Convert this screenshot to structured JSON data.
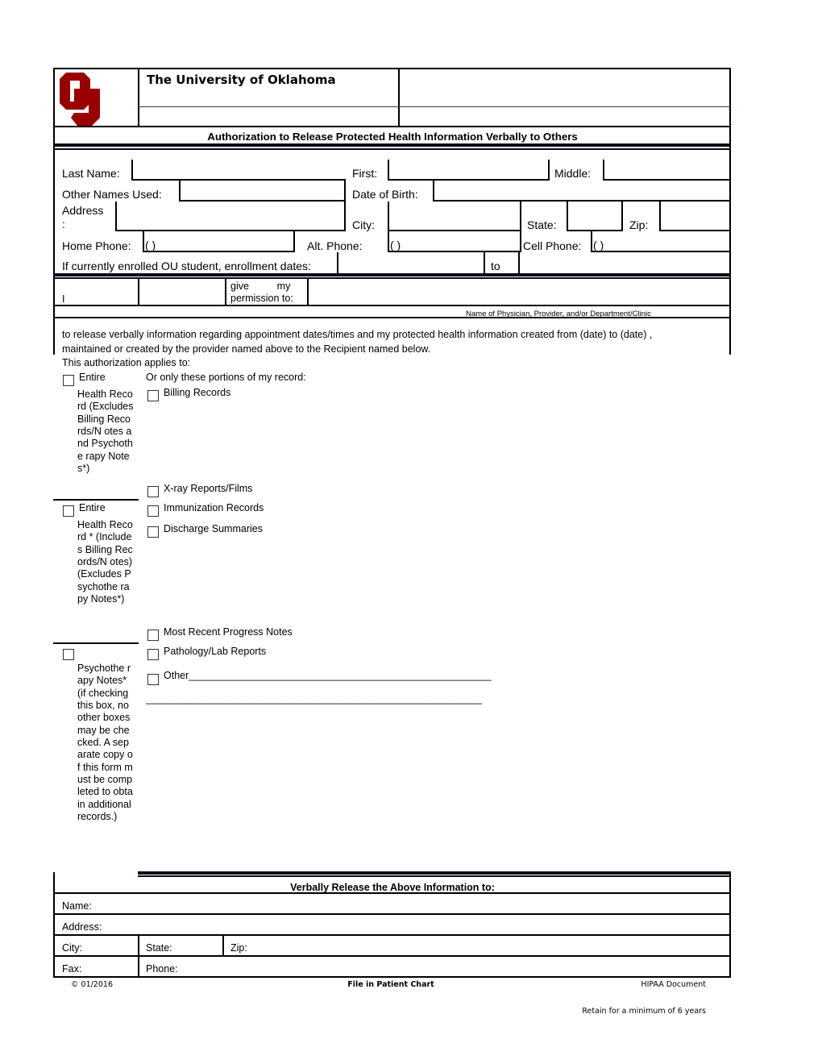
{
  "header": {
    "logo": "ou-logo",
    "institution": "The University of Oklahoma",
    "brand_color": "#990000",
    "form_title": "Authorization to Release Protected Health Information Verbally to Others"
  },
  "patient": {
    "last_name_label": "Last Name:",
    "first_label": "First:",
    "middle_label": "Middle:",
    "other_names_label": "Other Names Used:",
    "dob_label": "Date of Birth:",
    "address_label_1": "Address",
    "address_label_2": ":",
    "city_label": "City:",
    "state_label": "State:",
    "zip_label": "Zip:",
    "home_phone_label": "Home Phone:",
    "home_phone_value": "(    )",
    "alt_phone_label": "Alt. Phone:",
    "alt_phone_value": "(    )",
    "cell_phone_label": "Cell Phone:",
    "cell_phone_value": "(    )",
    "enrollment_label": "If currently enrolled OU student, enrollment dates:",
    "enrollment_to": "to"
  },
  "permission": {
    "i_label": "I",
    "give_my": "give          my",
    "permission_to": "permission to:",
    "provider_caption": "Name of Physician, Provider, and/or Department/Clinic"
  },
  "statement": {
    "line1": "to release verbally information regarding appointment dates/times and my protected health information created from (date)  to (date) ,",
    "line2": "maintained or created by the provider named above to the Recipient named below.",
    "applies_to": "This authorization applies to:"
  },
  "options": {
    "left": [
      {
        "first": "Entire",
        "rest": "Health Record (Excludes Billing Records/N otes and Psychothe rapy Notes*)"
      },
      {
        "first": "Entire",
        "rest": "Health Record * (Includes Billing Records/N otes) (Excludes Psychothe rapy Notes*)"
      },
      {
        "first": "",
        "rest": "Psychothe rapy Notes* (if checking this box, no other boxes may be checked. A separate copy of this form must be completed to obtain additional records.)"
      }
    ],
    "portions_header": "Or only these portions of my record:",
    "right": [
      "Billing Records",
      "X-ray Reports/Films",
      "Immunization Records",
      "Discharge Summaries",
      "Most Recent Progress Notes",
      "Pathology/Lab Reports",
      "Other______________________________________________________"
    ],
    "other_line2": "____________________________________________________________"
  },
  "recipient": {
    "title": "Verbally Release the Above Information to:",
    "name_label": "Name:",
    "address_label": "Address:",
    "city_label": "City:",
    "state_label": "State:",
    "zip_label": "Zip:",
    "fax_label": "Fax:",
    "phone_label": "Phone:"
  },
  "footer": {
    "copyright": "© 01/2016",
    "file_note": "File in Patient Chart",
    "doc_type": "HIPAA Document",
    "retention": "Retain for a minimum of 6 years"
  }
}
